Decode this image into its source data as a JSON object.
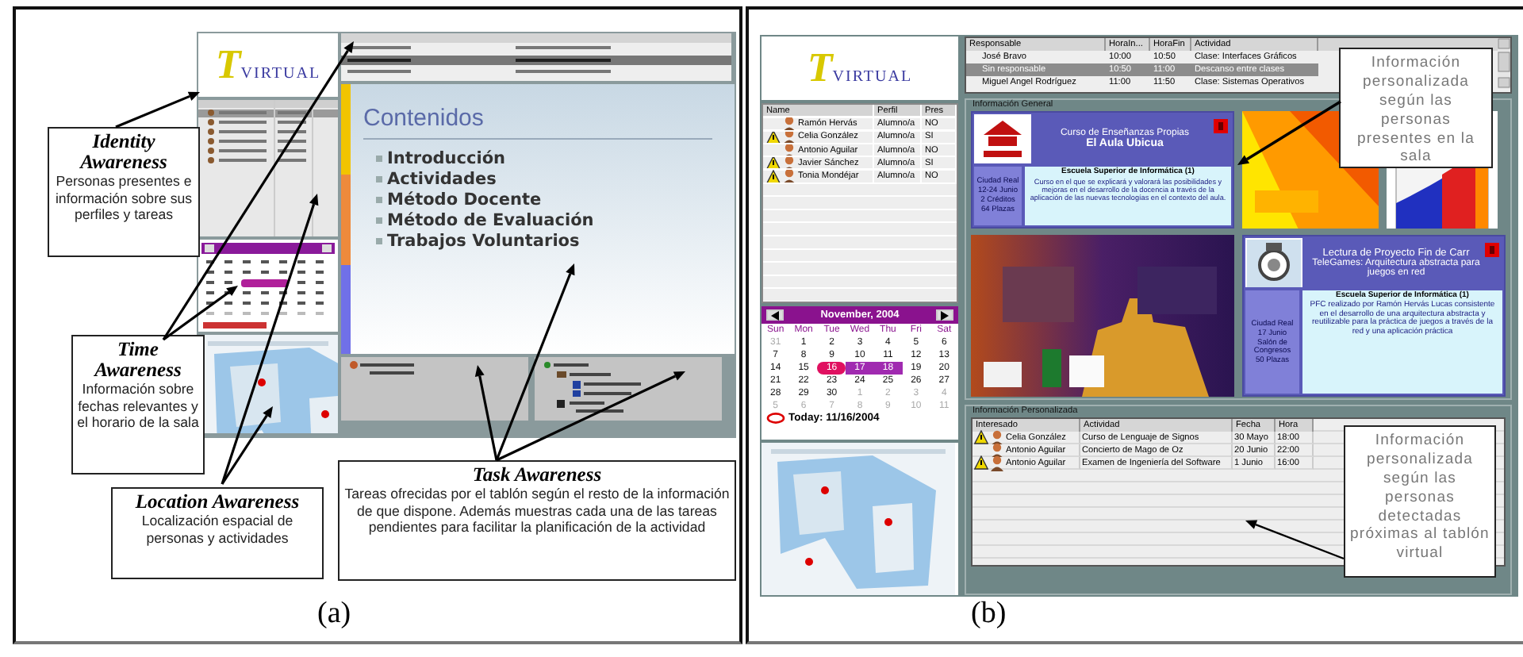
{
  "panel_a": {
    "caption": "(a)",
    "logo": {
      "initial": "T",
      "word": "VIRTUAL"
    },
    "slide": {
      "title": "Contenidos",
      "items": [
        "Introducción",
        "Actividades",
        "Método Docente",
        "Método de Evaluación",
        "Trabajos Voluntarios"
      ]
    },
    "annotations": [
      {
        "title": "Identity Awareness",
        "text": "Personas presentes e información sobre sus perfiles y tareas"
      },
      {
        "title": "Time Awareness",
        "text": "Información sobre fechas relevantes y el horario de la sala"
      },
      {
        "title": "Location Awareness",
        "text": "Localización espacial de personas y actividades"
      },
      {
        "title": "Task Awareness",
        "text": "Tareas ofrecidas por el tablón según el resto de la información de que dispone. Además muestras cada una de las tareas pendientes para facilitar la planificación de la actividad"
      }
    ]
  },
  "panel_b": {
    "caption": "(b)",
    "logo": {
      "initial": "T",
      "word": "VIRTUAL"
    },
    "people": {
      "columns": [
        "Name",
        "Perfil",
        "Pres"
      ],
      "rows": [
        {
          "name": "Ramón Hervás",
          "profile": "Alumno/a",
          "present": "NO",
          "warning": false
        },
        {
          "name": "Celia González",
          "profile": "Alumno/a",
          "present": "SI",
          "warning": true
        },
        {
          "name": "Antonio Aguilar",
          "profile": "Alumno/a",
          "present": "NO",
          "warning": false
        },
        {
          "name": "Javier Sánchez",
          "profile": "Alumno/a",
          "present": "SI",
          "warning": true
        },
        {
          "name": "Tonia Mondéjar",
          "profile": "Alumno/a",
          "present": "NO",
          "warning": true
        }
      ]
    },
    "calendar": {
      "month": "November, 2004",
      "weekdays": [
        "Sun",
        "Mon",
        "Tue",
        "Wed",
        "Thu",
        "Fri",
        "Sat"
      ],
      "weeks": [
        [
          {
            "day": "31",
            "other_month": true,
            "today": false,
            "highlighted": false
          },
          {
            "day": "1",
            "other_month": false,
            "today": false,
            "highlighted": false
          },
          {
            "day": "2",
            "other_month": false,
            "today": false,
            "highlighted": false
          },
          {
            "day": "3",
            "other_month": false,
            "today": false,
            "highlighted": false
          },
          {
            "day": "4",
            "other_month": false,
            "today": false,
            "highlighted": false
          },
          {
            "day": "5",
            "other_month": false,
            "today": false,
            "highlighted": false
          },
          {
            "day": "6",
            "other_month": false,
            "today": false,
            "highlighted": false
          }
        ],
        [
          {
            "day": "7",
            "other_month": false,
            "today": false,
            "highlighted": false
          },
          {
            "day": "8",
            "other_month": false,
            "today": false,
            "highlighted": false
          },
          {
            "day": "9",
            "other_month": false,
            "today": false,
            "highlighted": false
          },
          {
            "day": "10",
            "other_month": false,
            "today": false,
            "highlighted": false
          },
          {
            "day": "11",
            "other_month": false,
            "today": false,
            "highlighted": false
          },
          {
            "day": "12",
            "other_month": false,
            "today": false,
            "highlighted": false
          },
          {
            "day": "13",
            "other_month": false,
            "today": false,
            "highlighted": false
          }
        ],
        [
          {
            "day": "14",
            "other_month": false,
            "today": false,
            "highlighted": false
          },
          {
            "day": "15",
            "other_month": false,
            "today": false,
            "highlighted": false
          },
          {
            "day": "16",
            "other_month": false,
            "today": true,
            "highlighted": true
          },
          {
            "day": "17",
            "other_month": false,
            "today": false,
            "highlighted": true
          },
          {
            "day": "18",
            "other_month": false,
            "today": false,
            "highlighted": true
          },
          {
            "day": "19",
            "other_month": false,
            "today": false,
            "highlighted": false
          },
          {
            "day": "20",
            "other_month": false,
            "today": false,
            "highlighted": false
          }
        ],
        [
          {
            "day": "21",
            "other_month": false,
            "today": false,
            "highlighted": false
          },
          {
            "day": "22",
            "other_month": false,
            "today": false,
            "highlighted": false
          },
          {
            "day": "23",
            "other_month": false,
            "today": false,
            "highlighted": false
          },
          {
            "day": "24",
            "other_month": false,
            "today": false,
            "highlighted": false
          },
          {
            "day": "25",
            "other_month": false,
            "today": false,
            "highlighted": false
          },
          {
            "day": "26",
            "other_month": false,
            "today": false,
            "highlighted": false
          },
          {
            "day": "27",
            "other_month": false,
            "today": false,
            "highlighted": false
          }
        ],
        [
          {
            "day": "28",
            "other_month": false,
            "today": false,
            "highlighted": false
          },
          {
            "day": "29",
            "other_month": false,
            "today": false,
            "highlighted": false
          },
          {
            "day": "30",
            "other_month": false,
            "today": false,
            "highlighted": false
          },
          {
            "day": "1",
            "other_month": true,
            "today": false,
            "highlighted": false
          },
          {
            "day": "2",
            "other_month": true,
            "today": false,
            "highlighted": false
          },
          {
            "day": "3",
            "other_month": true,
            "today": false,
            "highlighted": false
          },
          {
            "day": "4",
            "other_month": true,
            "today": false,
            "highlighted": false
          }
        ],
        [
          {
            "day": "5",
            "other_month": true,
            "today": false,
            "highlighted": false
          },
          {
            "day": "6",
            "other_month": true,
            "today": false,
            "highlighted": false
          },
          {
            "day": "7",
            "other_month": true,
            "today": false,
            "highlighted": false
          },
          {
            "day": "8",
            "other_month": true,
            "today": false,
            "highlighted": false
          },
          {
            "day": "9",
            "other_month": true,
            "today": false,
            "highlighted": false
          },
          {
            "day": "10",
            "other_month": true,
            "today": false,
            "highlighted": false
          },
          {
            "day": "11",
            "other_month": true,
            "today": false,
            "highlighted": false
          }
        ]
      ],
      "today_label": "Today: 11/16/2004"
    },
    "schedule": {
      "columns": [
        "Responsable",
        "HoraIn...",
        "HoraFin",
        "Actividad"
      ],
      "rows": [
        {
          "person": "José Bravo",
          "start": "10:00",
          "end": "10:50",
          "activity": "Clase: Interfaces Gráficos",
          "selected": false
        },
        {
          "person": "Sin responsable",
          "start": "10:50",
          "end": "11:00",
          "activity": "Descanso entre clases",
          "selected": true
        },
        {
          "person": "Miguel Angel Rodríguez",
          "start": "11:00",
          "end": "11:50",
          "activity": "Clase: Sistemas Operativos",
          "selected": false
        }
      ]
    },
    "general": {
      "title": "Información General",
      "course": {
        "heading": "Curso de Enseñanzas Propias",
        "title": "El Aula Ubicua",
        "details": [
          "Ciudad Real",
          "12-24 Junio",
          "2 Créditos",
          "64 Plazas"
        ],
        "school": "Escuela Superior de Informática (1)",
        "description": "Curso en el que se explicará y valorará las posibilidades y mejoras en el desarrollo de la docencia a través de la aplicación de las nuevas tecnologías en el contexto del aula."
      },
      "thesis": {
        "heading": "Lectura de Proyecto Fin de Carr",
        "title": "TeleGames: Arquitectura abstracta para juegos en red",
        "details": [
          "Ciudad Real",
          "17 Junio",
          "Salón de Congresos",
          "50 Plazas"
        ],
        "school": "Escuela Superior de Informática (1)",
        "description": "PFC realizado por Ramón Hervás Lucas consistente en el desarrollo de una arquitectura abstracta y reutilizable para la práctica de juegos a través de la red y una aplicación práctica"
      }
    },
    "personal": {
      "title": "Información Personalizada",
      "columns": [
        "Interesado",
        "Actividad",
        "Fecha",
        "Hora"
      ],
      "rows": [
        {
          "person": "Celia González",
          "activity": "Curso de Lenguaje de Signos",
          "date": "30 Mayo",
          "time": "18:00",
          "warning": true
        },
        {
          "person": "Antonio Aguilar",
          "activity": "Concierto de Mago de Oz",
          "date": "20 Junio",
          "time": "22:00",
          "warning": false
        },
        {
          "person": "Antonio Aguilar",
          "activity": "Examen de Ingeniería del Software",
          "date": "1 Junio",
          "time": "16:00",
          "warning": true
        }
      ]
    },
    "annotations": [
      {
        "text": "Información personalizada según las personas presentes en la sala"
      },
      {
        "text": "Información personalizada según las personas detectadas próximas al tablón virtual"
      }
    ]
  }
}
